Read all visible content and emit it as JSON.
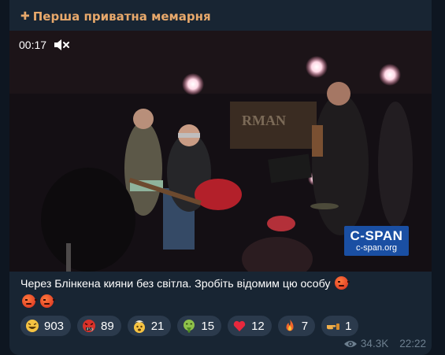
{
  "channel": {
    "name": "Перша приватна мемарня",
    "plus_icon": "plus-icon"
  },
  "video": {
    "time": "00:17",
    "mute_icon": "speaker-muted-icon",
    "watermark": {
      "line1": "C-SPAN",
      "line2": "c-span.org"
    }
  },
  "message": {
    "text": "Через Блінкена кияни без світла. Зробіть відомим цю особу"
  },
  "reactions": [
    {
      "icon": "laughing-face-icon",
      "count": "903"
    },
    {
      "icon": "cursing-face-icon",
      "count": "89"
    },
    {
      "icon": "exploding-head-icon",
      "count": "21"
    },
    {
      "icon": "vomiting-face-icon",
      "count": "15"
    },
    {
      "icon": "heart-icon",
      "count": "12"
    },
    {
      "icon": "fire-icon",
      "count": "7"
    },
    {
      "icon": "hand-icon",
      "count": "1"
    }
  ],
  "meta": {
    "views": "34.3K",
    "time": "22:22"
  },
  "colors": {
    "background": "#0e1621",
    "bubble": "#182533",
    "channel": "#e7a86b",
    "reaction_bg": "#2b3a4c",
    "meta": "#6d7f8f"
  }
}
